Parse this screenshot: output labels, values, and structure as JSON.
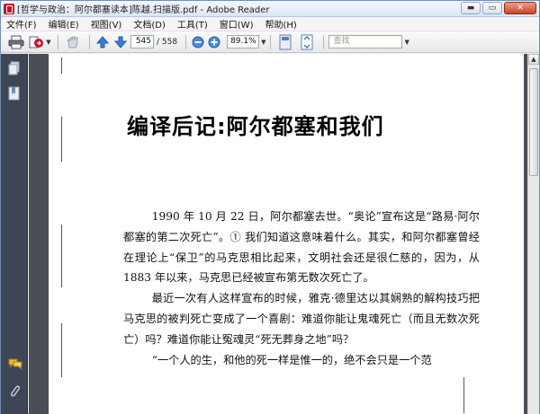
{
  "window": {
    "title": "[哲学与政治：阿尔都塞读本]陈越.扫描版.pdf - Adobe Reader",
    "minimize_label": "▬",
    "maximize_label": "▭",
    "close_label": "✕"
  },
  "menu": {
    "items": [
      {
        "label": "文件(F)"
      },
      {
        "label": "编辑(E)"
      },
      {
        "label": "视图(V)"
      },
      {
        "label": "文档(D)"
      },
      {
        "label": "工具(T)"
      },
      {
        "label": "窗口(W)"
      },
      {
        "label": "帮助(H)"
      }
    ]
  },
  "toolbar": {
    "current_page": "545",
    "page_total": "/ 558",
    "zoom": "89.1%",
    "search_placeholder": "查找",
    "icons": [
      "print-icon",
      "share-icon",
      "hand-icon",
      "page-up-icon",
      "page-down-icon",
      "zoom-out-icon",
      "zoom-in-icon",
      "fit-page-icon",
      "full-screen-icon"
    ]
  },
  "sidebar": {
    "icons": [
      "pages-icon",
      "bookmarks-icon",
      "comments-icon",
      "attachments-icon"
    ]
  },
  "document": {
    "chapter_title": "编译后记:阿尔都塞和我们",
    "paragraphs": [
      "1990 年 10 月 22 日，阿尔都塞去世。“奥论”宣布这是“路易·阿尔都塞的第二次死亡”。① 我们知道这意味着什么。其实，和阿尔都塞曾经在理论上“保卫”的马克思相比起来，文明社会还是很仁慈的，因为，从 1883 年以来，马克思已经被宣布第无数次死亡了。",
      "最近一次有人这样宣布的时候，雅克·德里达以其娴熟的解构技巧把马克思的被判死亡变成了一个喜剧：难道你能让鬼魂死亡（而且无数次死亡）吗？难道你能让冤魂灵“死无葬身之地”吗？",
      "“一个人的生，和他的死一样是惟一的，绝不会只是一个范"
    ]
  }
}
